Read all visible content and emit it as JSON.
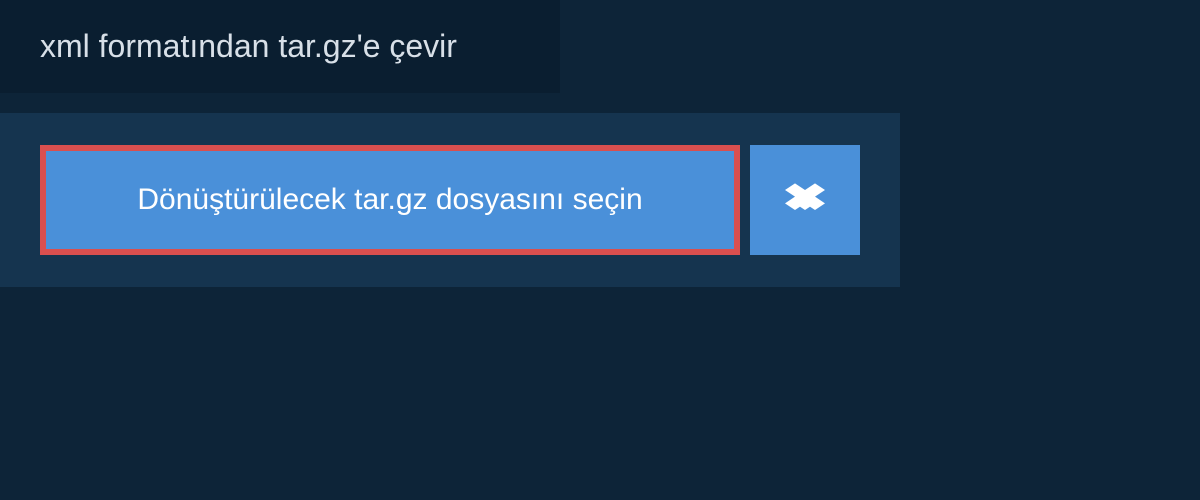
{
  "header": {
    "title": "xml formatından tar.gz'e çevir"
  },
  "main": {
    "select_file_label": "Dönüştürülecek tar.gz dosyasını seçin"
  },
  "colors": {
    "background": "#0d2438",
    "panel": "#15344f",
    "header_bg": "#0a1e30",
    "button_bg": "#4a90d9",
    "button_border": "#d94f4f"
  }
}
